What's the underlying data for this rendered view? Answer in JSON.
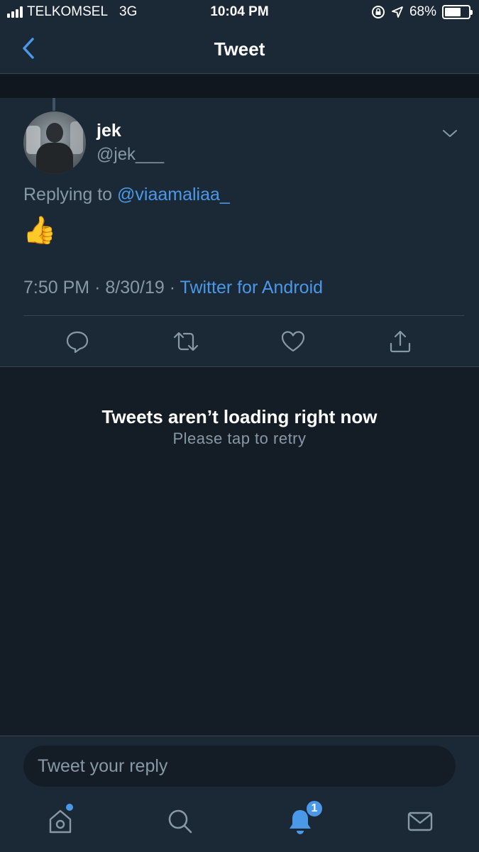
{
  "status_bar": {
    "carrier": "TELKOMSEL",
    "network": "3G",
    "time": "10:04 PM",
    "battery": "68%",
    "battery_level": 0.68,
    "icons": [
      "signal-icon",
      "rotation-lock-icon",
      "location-icon",
      "battery-icon"
    ]
  },
  "header": {
    "title": "Tweet",
    "back_icon": "chevron-left-icon"
  },
  "tweet": {
    "author_name": "jek",
    "author_handle": "@jek___",
    "replying_prefix": "Replying to",
    "replying_to": "@viaamaliaa_",
    "content": "👍",
    "time": "7:50 PM",
    "separator": "·",
    "date": "8/30/19",
    "source": "Twitter for Android",
    "actions": [
      "reply-icon",
      "retweet-icon",
      "like-icon",
      "share-icon"
    ]
  },
  "error": {
    "title": "Tweets aren’t loading right now",
    "subtitle": "Please tap to retry"
  },
  "reply": {
    "placeholder": "Tweet your reply"
  },
  "tabbar": {
    "items": [
      "home-icon",
      "search-icon",
      "notifications-icon",
      "messages-icon"
    ],
    "notifications_badge": "1"
  },
  "colors": {
    "background": "#141d26",
    "surface": "#1b2836",
    "accent": "#4a99e9",
    "muted": "#8899a6",
    "divider": "#38444d"
  }
}
